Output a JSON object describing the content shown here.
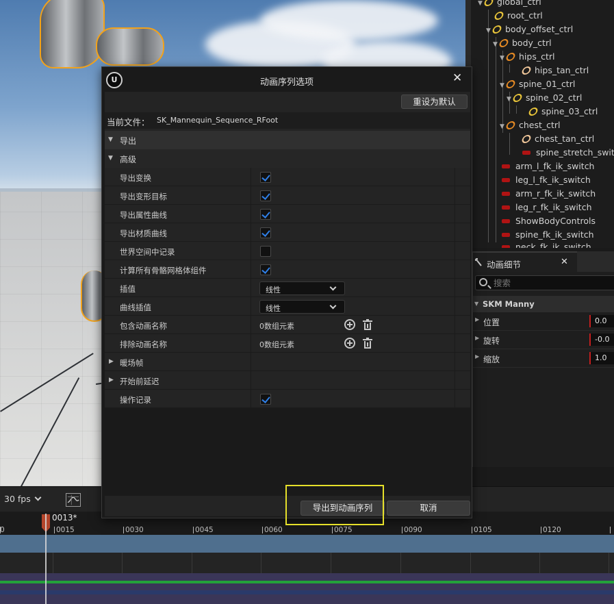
{
  "dialog": {
    "title": "动画序列选项",
    "reset_label": "重设为默认",
    "current_file_label": "当前文件：",
    "current_file_value": "SK_Mannequin_Sequence_RFoot",
    "categories": {
      "export": "导出",
      "advanced": "高级"
    },
    "options": [
      {
        "label": "导出变换",
        "checked": true
      },
      {
        "label": "导出变形目标",
        "checked": true
      },
      {
        "label": "导出属性曲线",
        "checked": true
      },
      {
        "label": "导出材质曲线",
        "checked": true
      },
      {
        "label": "世界空间中记录",
        "checked": false
      },
      {
        "label": "计算所有骨骼网格体组件",
        "checked": true
      }
    ],
    "interpolation": {
      "label": "插值",
      "value": "线性"
    },
    "curve_interpolation": {
      "label": "曲线插值",
      "value": "线性"
    },
    "include_anim_names": {
      "label": "包含动画名称",
      "value": "0数组元素"
    },
    "exclude_anim_names": {
      "label": "排除动画名称",
      "value": "0数组元素"
    },
    "warmup_frames": "暖场帧",
    "delay_before_start": "开始前延迟",
    "transact_recording": {
      "label": "操作记录",
      "checked": true
    },
    "export_button": "导出到动画序列",
    "cancel_button": "取消"
  },
  "outliner": {
    "items": [
      {
        "label": "global_ctrl",
        "icon": "ctrl-yellow",
        "expanded": true
      },
      {
        "label": "root_ctrl",
        "icon": "ctrl-yellow"
      },
      {
        "label": "body_offset_ctrl",
        "icon": "ctrl-yellow",
        "expanded": true
      },
      {
        "label": "body_ctrl",
        "icon": "ctrl-orange",
        "expanded": true
      },
      {
        "label": "hips_ctrl",
        "icon": "ctrl-orange",
        "expanded": true
      },
      {
        "label": "hips_tan_ctrl",
        "icon": "ctrl-peach"
      },
      {
        "label": "spine_01_ctrl",
        "icon": "ctrl-orange",
        "expanded": true
      },
      {
        "label": "spine_02_ctrl",
        "icon": "ctrl-yellow",
        "expanded": true
      },
      {
        "label": "spine_03_ctrl",
        "icon": "ctrl-yellow"
      },
      {
        "label": "chest_ctrl",
        "icon": "ctrl-orange",
        "expanded": true
      },
      {
        "label": "chest_tan_ctrl",
        "icon": "ctrl-peach"
      },
      {
        "label": "spine_stretch_switch",
        "icon": "switch-red"
      },
      {
        "label": "arm_l_fk_ik_switch",
        "icon": "switch-red"
      },
      {
        "label": "leg_l_fk_ik_switch",
        "icon": "switch-red"
      },
      {
        "label": "arm_r_fk_ik_switch",
        "icon": "switch-red"
      },
      {
        "label": "leg_r_fk_ik_switch",
        "icon": "switch-red"
      },
      {
        "label": "ShowBodyControls",
        "icon": "switch-red"
      },
      {
        "label": "spine_fk_ik_switch",
        "icon": "switch-red"
      },
      {
        "label": "neck_fk_ik_switch",
        "icon": "switch-red"
      }
    ]
  },
  "details": {
    "tab_label": "动画细节",
    "search_placeholder": "搜索",
    "section": "SKM Manny",
    "props": [
      {
        "label": "位置",
        "value": "0.0"
      },
      {
        "label": "旋转",
        "value": "-0.0"
      },
      {
        "label": "缩放",
        "value": "1.0"
      }
    ]
  },
  "timeline": {
    "fps": "30 fps",
    "current_frame": "0013*",
    "ticks": [
      "0",
      "0015",
      "0030",
      "0045",
      "0060",
      "0075",
      "0090",
      "0105",
      "0120"
    ]
  },
  "colors": {
    "accent_blue": "#2f7fe6",
    "selection_orange": "#f2a21a",
    "highlight_yellow": "#e6e02a",
    "switch_red": "#b01313"
  }
}
